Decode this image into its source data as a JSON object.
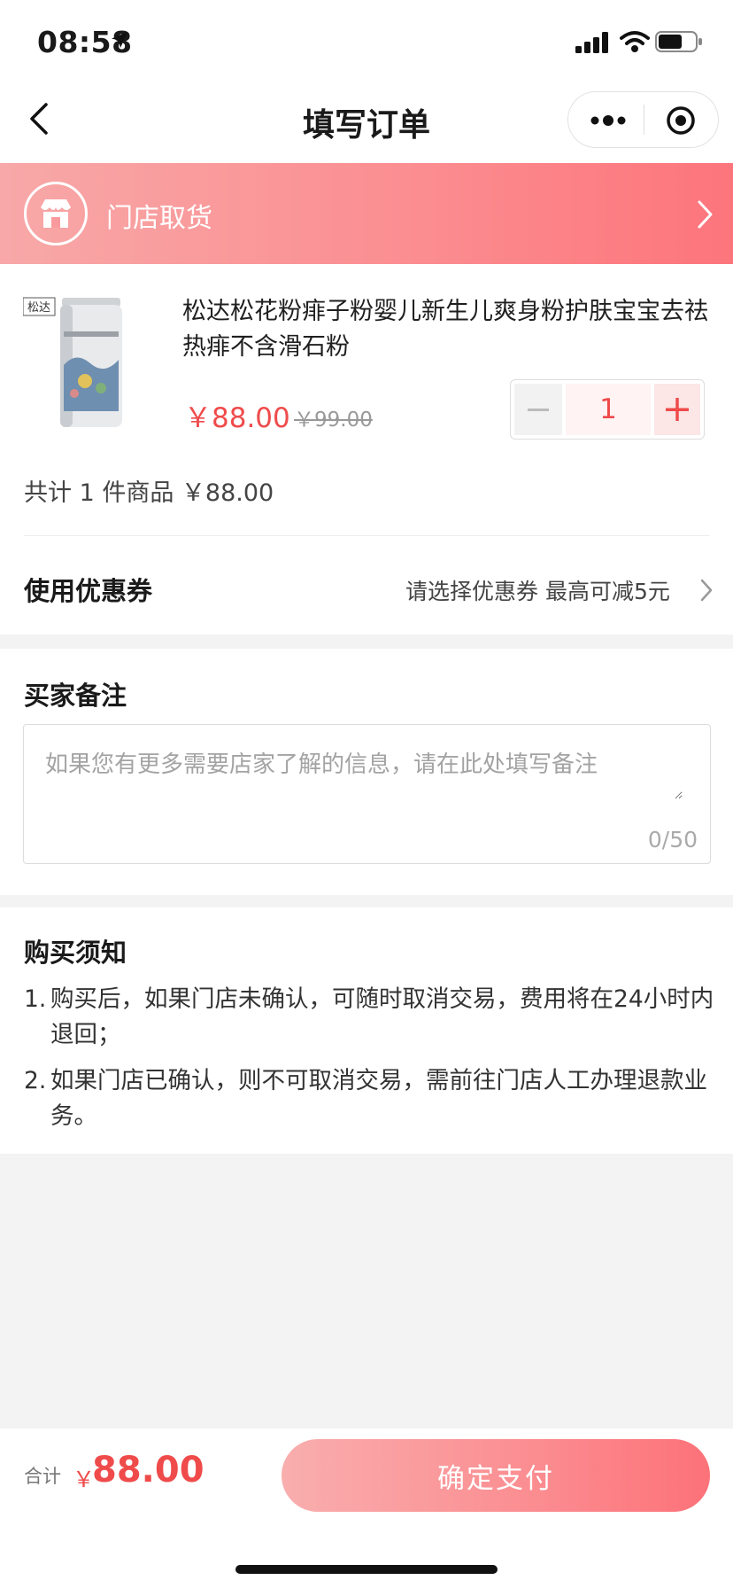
{
  "status_bar": {
    "time": "08:58",
    "icons": [
      "location-arrow-icon",
      "signal-icon",
      "wifi-icon",
      "battery-icon"
    ]
  },
  "nav": {
    "title": "填写订单",
    "back_icon": "chevron-left-icon",
    "more_icon": "more-dots-icon",
    "close_icon": "target-circle-icon"
  },
  "pickup": {
    "label": "门店取货",
    "icon": "store-icon",
    "chevron": "chevron-right-icon"
  },
  "product": {
    "title": "松达松花粉痱子粉婴儿新生儿爽身粉护肤宝宝去祛热痱不含滑石粉",
    "price": "￥88.00",
    "original_price": "￥99.00",
    "quantity": "1",
    "image_brand_text": "松达"
  },
  "summary": {
    "total_line": "共计 1 件商品 ￥88.00"
  },
  "coupon": {
    "label": "使用优惠券",
    "value": "请选择优惠券 最高可减5元"
  },
  "remark": {
    "title": "买家备注",
    "placeholder": "如果您有更多需要店家了解的信息，请在此处填写备注",
    "counter": "0/50"
  },
  "notice": {
    "title": "购买须知",
    "items": [
      {
        "num": "1.",
        "text": "购买后，如果门店未确认，可随时取消交易，费用将在24小时内退回；"
      },
      {
        "num": "2.",
        "text": "如果门店已确认，则不可取消交易，需前往门店人工办理退款业务。"
      }
    ]
  },
  "footer": {
    "total_label": "合计",
    "currency": "￥",
    "total_value": "88.00",
    "pay_button": "确定支付"
  },
  "colors": {
    "accent": "#ef4b4b",
    "gradient_start": "#f8a8a8",
    "gradient_end": "#fc757c"
  }
}
